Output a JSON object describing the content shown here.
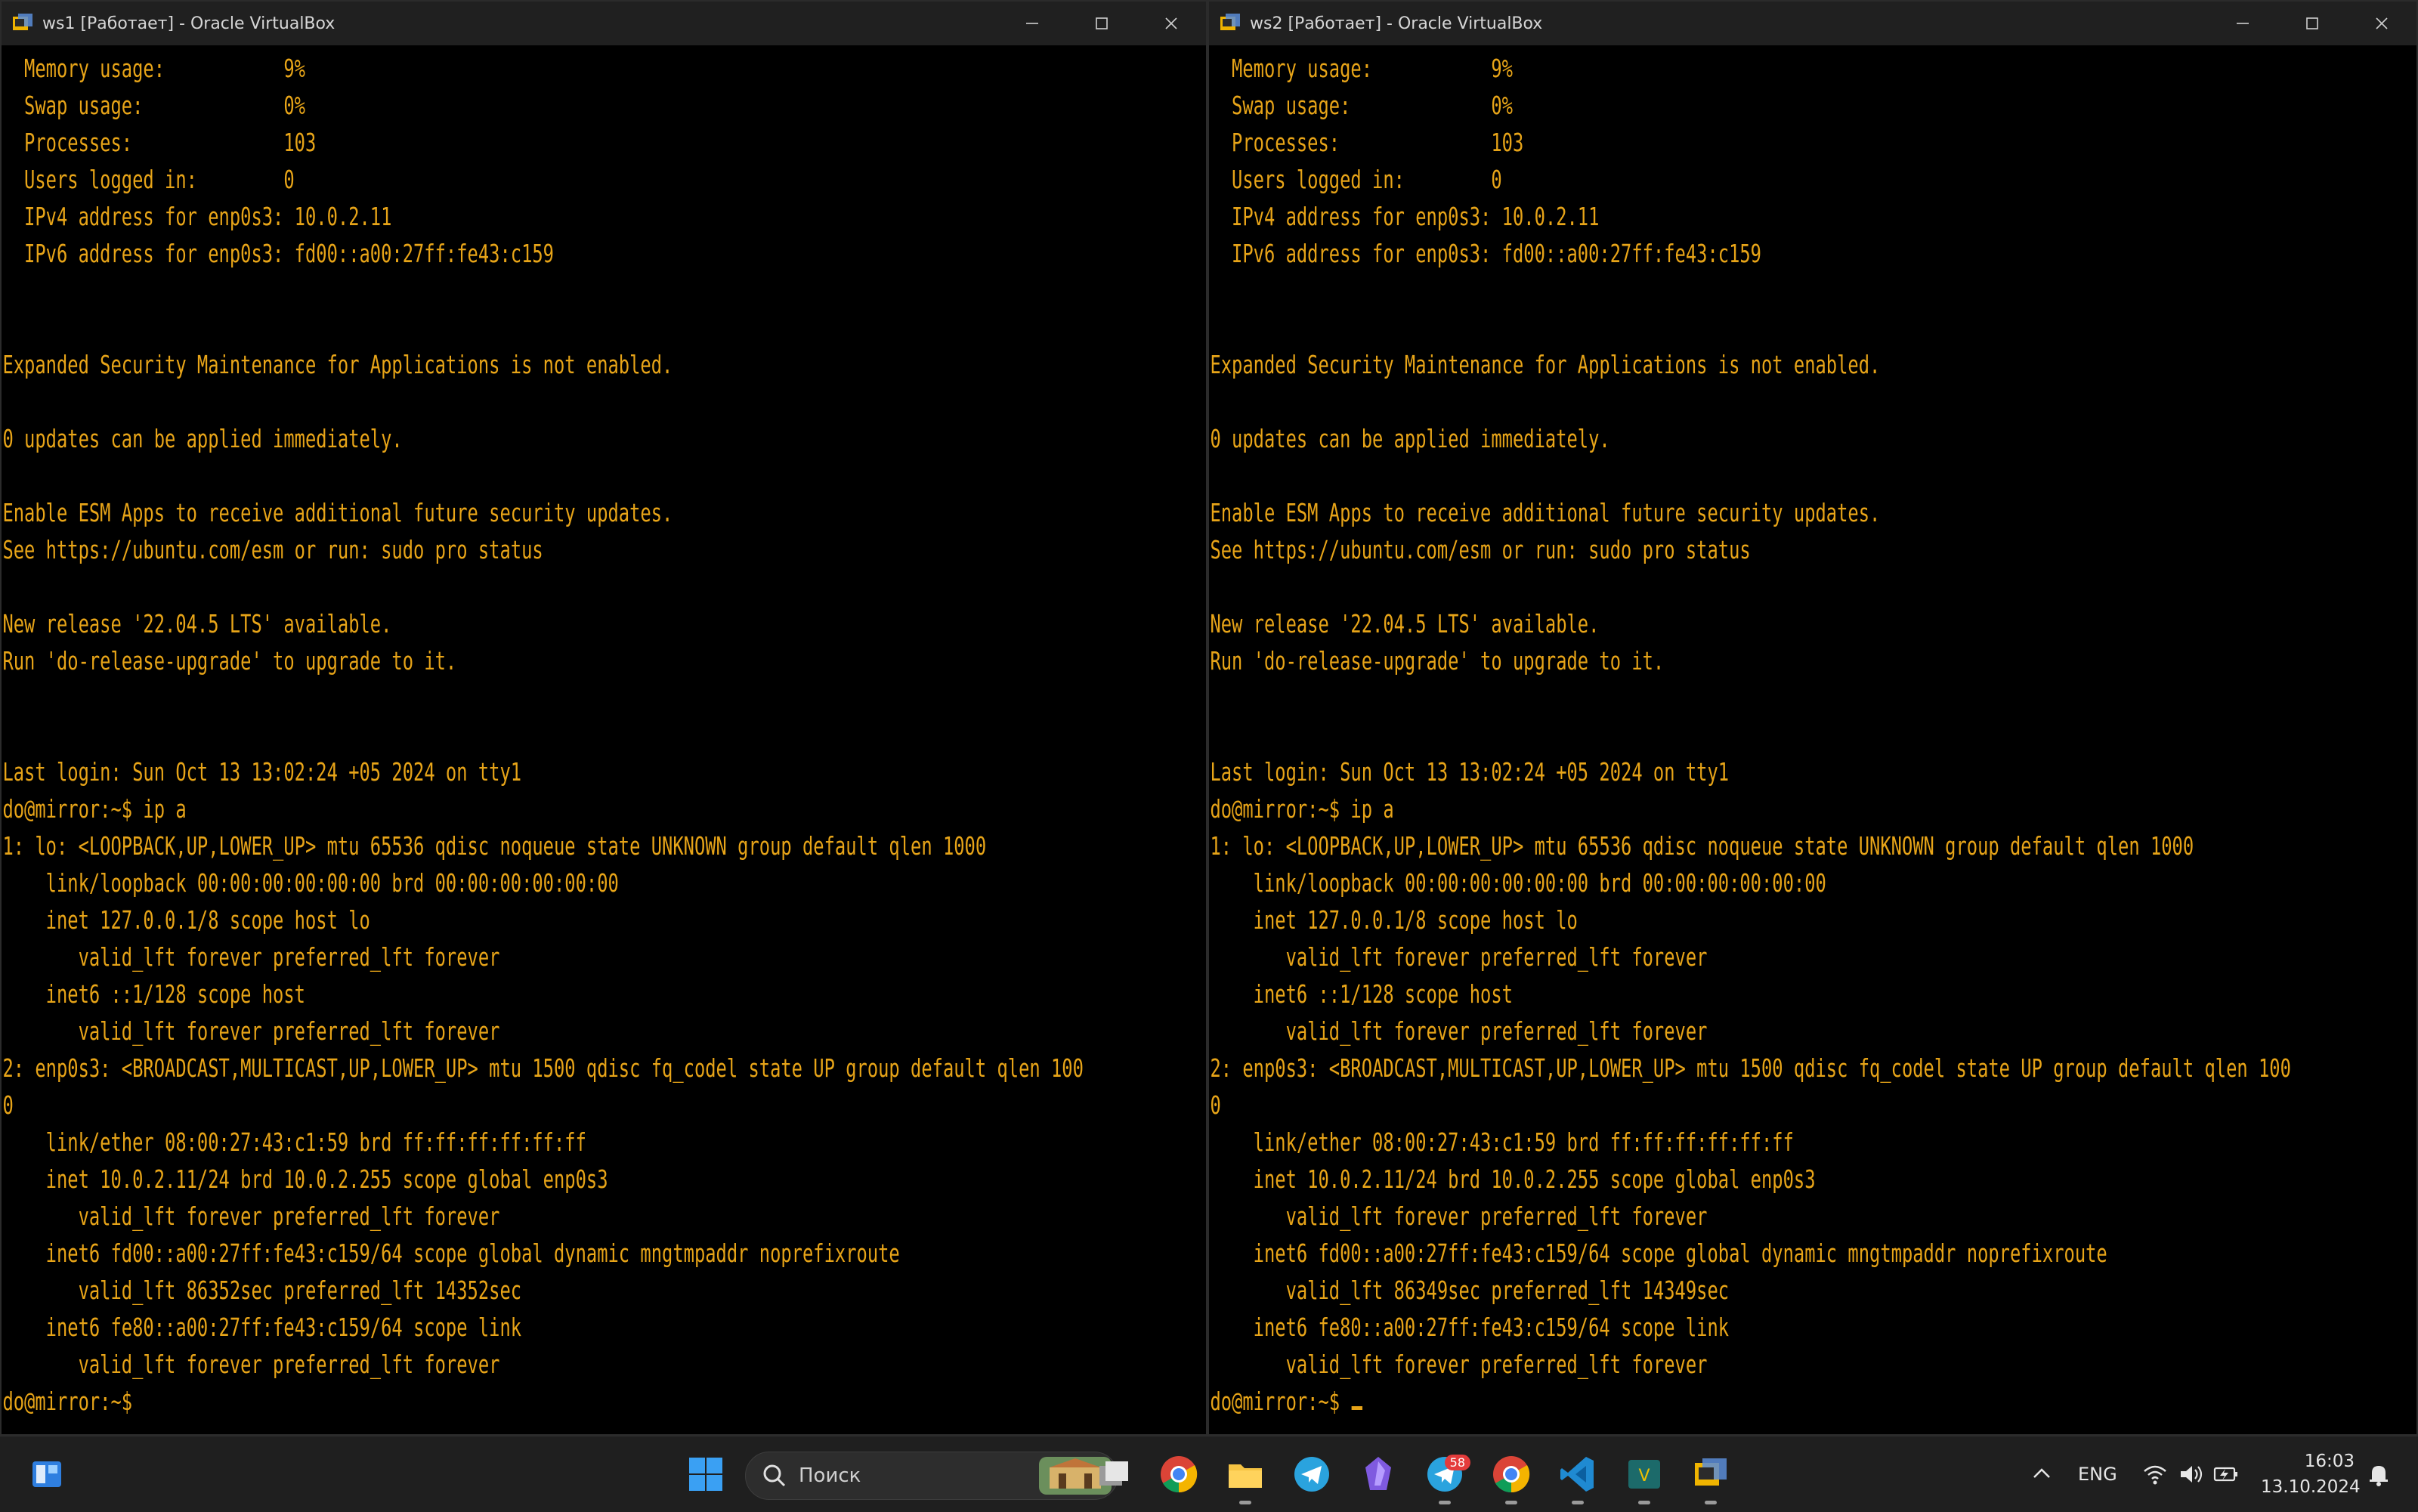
{
  "windows": [
    {
      "title": "ws1 [Работает] - Oracle VirtualBox",
      "terminal_lines": [
        "  Memory usage:           9%",
        "  Swap usage:             0%",
        "  Processes:              103",
        "  Users logged in:        0",
        "  IPv4 address for enp0s3: 10.0.2.11",
        "  IPv6 address for enp0s3: fd00::a00:27ff:fe43:c159",
        "",
        "",
        "Expanded Security Maintenance for Applications is not enabled.",
        "",
        "0 updates can be applied immediately.",
        "",
        "Enable ESM Apps to receive additional future security updates.",
        "See https://ubuntu.com/esm or run: sudo pro status",
        "",
        "New release '22.04.5 LTS' available.",
        "Run 'do-release-upgrade' to upgrade to it.",
        "",
        "",
        "Last login: Sun Oct 13 13:02:24 +05 2024 on tty1",
        "do@mirror:~$ ip a",
        "1: lo: <LOOPBACK,UP,LOWER_UP> mtu 65536 qdisc noqueue state UNKNOWN group default qlen 1000",
        "    link/loopback 00:00:00:00:00:00 brd 00:00:00:00:00:00",
        "    inet 127.0.0.1/8 scope host lo",
        "       valid_lft forever preferred_lft forever",
        "    inet6 ::1/128 scope host",
        "       valid_lft forever preferred_lft forever",
        "2: enp0s3: <BROADCAST,MULTICAST,UP,LOWER_UP> mtu 1500 qdisc fq_codel state UP group default qlen 100",
        "0",
        "    link/ether 08:00:27:43:c1:59 brd ff:ff:ff:ff:ff:ff",
        "    inet 10.0.2.11/24 brd 10.0.2.255 scope global enp0s3",
        "       valid_lft forever preferred_lft forever",
        "    inet6 fd00::a00:27ff:fe43:c159/64 scope global dynamic mngtmpaddr noprefixroute",
        "       valid_lft 86352sec preferred_lft 14352sec",
        "    inet6 fe80::a00:27ff:fe43:c159/64 scope link",
        "       valid_lft forever preferred_lft forever",
        "do@mirror:~$"
      ]
    },
    {
      "title": "ws2 [Работает] - Oracle VirtualBox",
      "terminal_lines": [
        "  Memory usage:           9%",
        "  Swap usage:             0%",
        "  Processes:              103",
        "  Users logged in:        0",
        "  IPv4 address for enp0s3: 10.0.2.11",
        "  IPv6 address for enp0s3: fd00::a00:27ff:fe43:c159",
        "",
        "",
        "Expanded Security Maintenance for Applications is not enabled.",
        "",
        "0 updates can be applied immediately.",
        "",
        "Enable ESM Apps to receive additional future security updates.",
        "See https://ubuntu.com/esm or run: sudo pro status",
        "",
        "New release '22.04.5 LTS' available.",
        "Run 'do-release-upgrade' to upgrade to it.",
        "",
        "",
        "Last login: Sun Oct 13 13:02:24 +05 2024 on tty1",
        "do@mirror:~$ ip a",
        "1: lo: <LOOPBACK,UP,LOWER_UP> mtu 65536 qdisc noqueue state UNKNOWN group default qlen 1000",
        "    link/loopback 00:00:00:00:00:00 brd 00:00:00:00:00:00",
        "    inet 127.0.0.1/8 scope host lo",
        "       valid_lft forever preferred_lft forever",
        "    inet6 ::1/128 scope host",
        "       valid_lft forever preferred_lft forever",
        "2: enp0s3: <BROADCAST,MULTICAST,UP,LOWER_UP> mtu 1500 qdisc fq_codel state UP group default qlen 100",
        "0",
        "    link/ether 08:00:27:43:c1:59 brd ff:ff:ff:ff:ff:ff",
        "    inet 10.0.2.11/24 brd 10.0.2.255 scope global enp0s3",
        "       valid_lft forever preferred_lft forever",
        "    inet6 fd00::a00:27ff:fe43:c159/64 scope global dynamic mngtmpaddr noprefixroute",
        "       valid_lft 86349sec preferred_lft 14349sec",
        "    inet6 fe80::a00:27ff:fe43:c159/64 scope link",
        "       valid_lft forever preferred_lft forever",
        "do@mirror:~$ "
      ]
    }
  ],
  "taskbar": {
    "search_placeholder": "Поиск",
    "telegram_badge": "58",
    "language": "ENG",
    "time": "16:03",
    "date": "13.10.2024"
  },
  "colors": {
    "terminal_text": "#e7a418",
    "terminal_bg": "#000000",
    "titlebar_bg": "#202020",
    "taskbar_bg": "#1f1f1f",
    "badge": "#e43b3b"
  }
}
